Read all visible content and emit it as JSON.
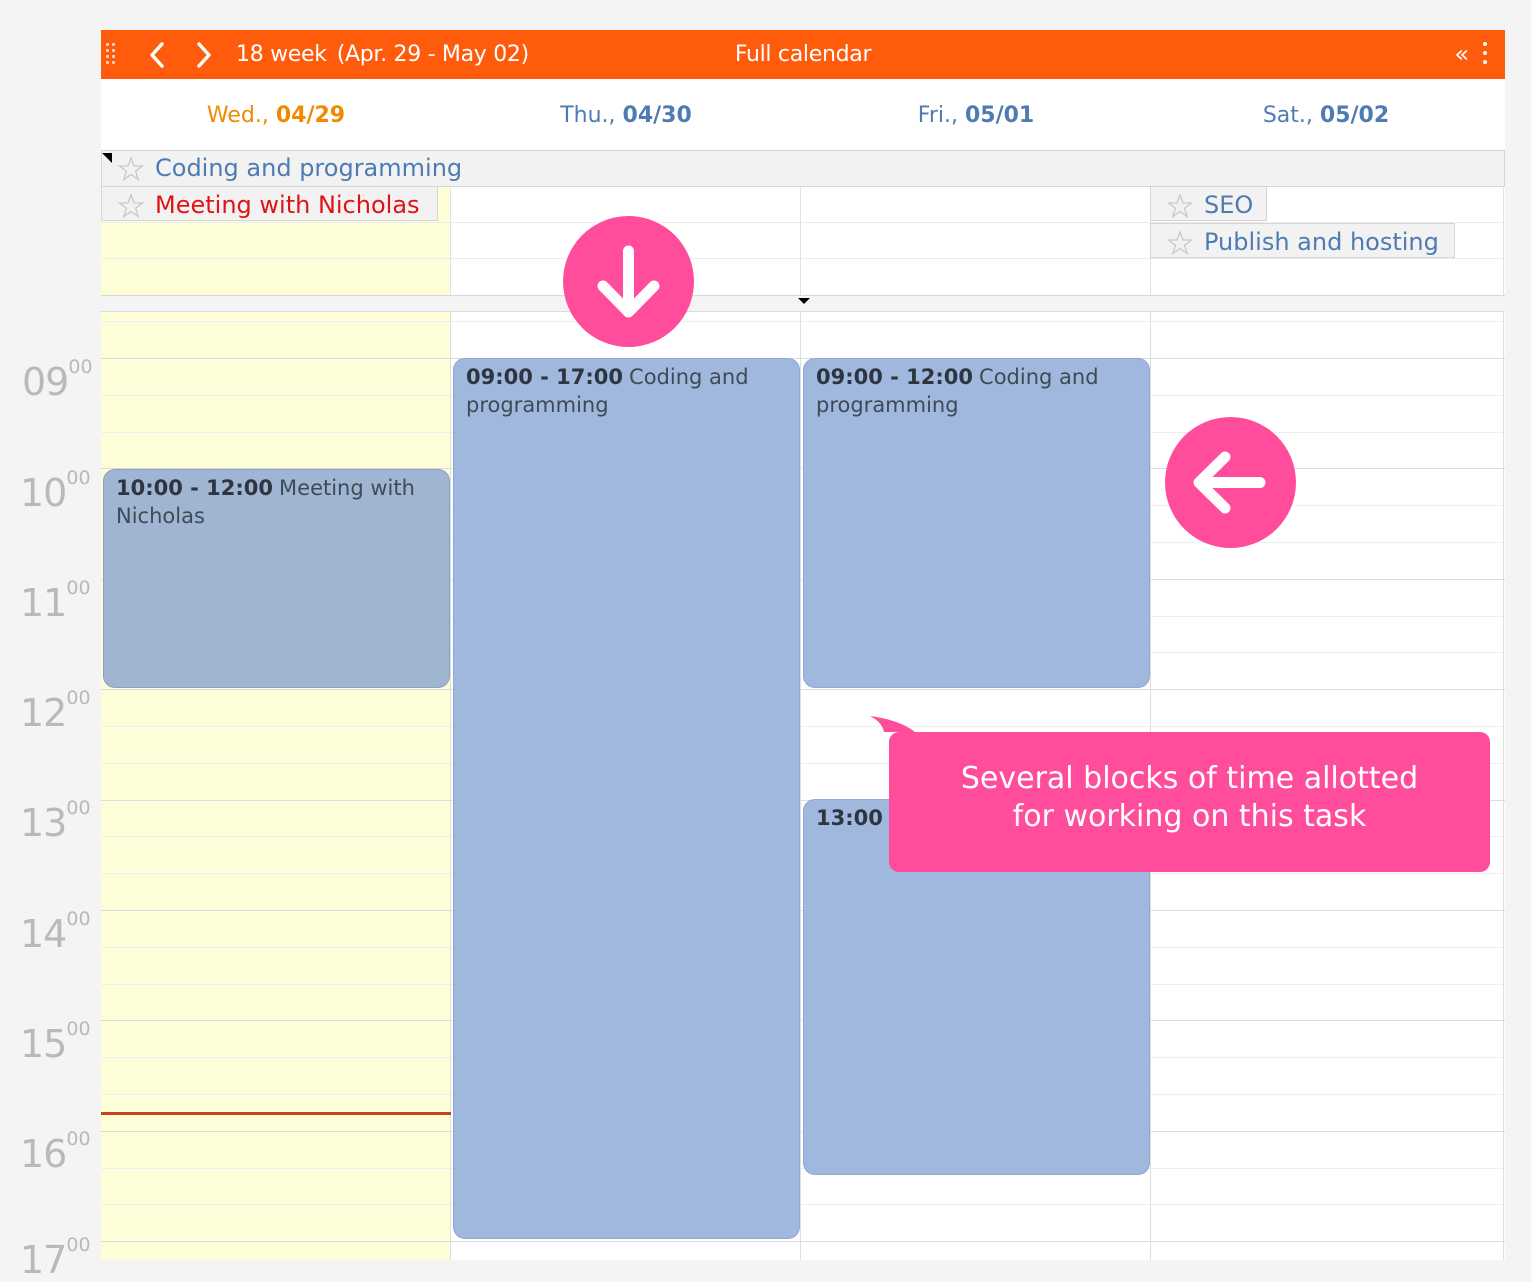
{
  "toolbar": {
    "week_label": "18 week",
    "range_label": "(Apr. 29 - May 02)",
    "title": "Full calendar",
    "collapse_label": "«"
  },
  "days": [
    {
      "name": "Wed.,",
      "date": "04/29",
      "today": true
    },
    {
      "name": "Thu.,",
      "date": "04/30",
      "today": false
    },
    {
      "name": "Fri.,",
      "date": "05/01",
      "today": false
    },
    {
      "name": "Sat.,",
      "date": "05/02",
      "today": false
    }
  ],
  "allday": {
    "span_task": "Coding and programming",
    "tasks": [
      {
        "label": "Meeting with Nicholas",
        "color": "#e01414"
      },
      {
        "label": "SEO",
        "color": "#4e7cb2"
      },
      {
        "label": "Publish and hosting",
        "color": "#4e7cb2"
      }
    ]
  },
  "hours": [
    {
      "h": "09",
      "m": "00"
    },
    {
      "h": "10",
      "m": "00"
    },
    {
      "h": "11",
      "m": "00"
    },
    {
      "h": "12",
      "m": "00"
    },
    {
      "h": "13",
      "m": "00"
    },
    {
      "h": "14",
      "m": "00"
    },
    {
      "h": "15",
      "m": "00"
    },
    {
      "h": "16",
      "m": "00"
    },
    {
      "h": "17",
      "m": "00"
    }
  ],
  "events": [
    {
      "time": "10:00 - 12:00",
      "title": "Meeting with Nicholas"
    },
    {
      "time": "09:00 - 17:00",
      "title": "Coding and programming"
    },
    {
      "time": "09:00 - 12:00",
      "title": "Coding and programming"
    },
    {
      "time": "13:00 -",
      "title": ""
    }
  ],
  "callout": {
    "line1": "Several blocks of time allotted",
    "line2": "for working on this task"
  },
  "colors": {
    "toolbar": "#ff5b0c",
    "today_text": "#f08a00",
    "day_text": "#4e7cb2",
    "today_column": "#fdfdd8",
    "event_blue": "#a0b7de",
    "event_grey": "#9fb5d2",
    "accent_pink": "#ff4d9c",
    "now_line": "#c9401c"
  }
}
